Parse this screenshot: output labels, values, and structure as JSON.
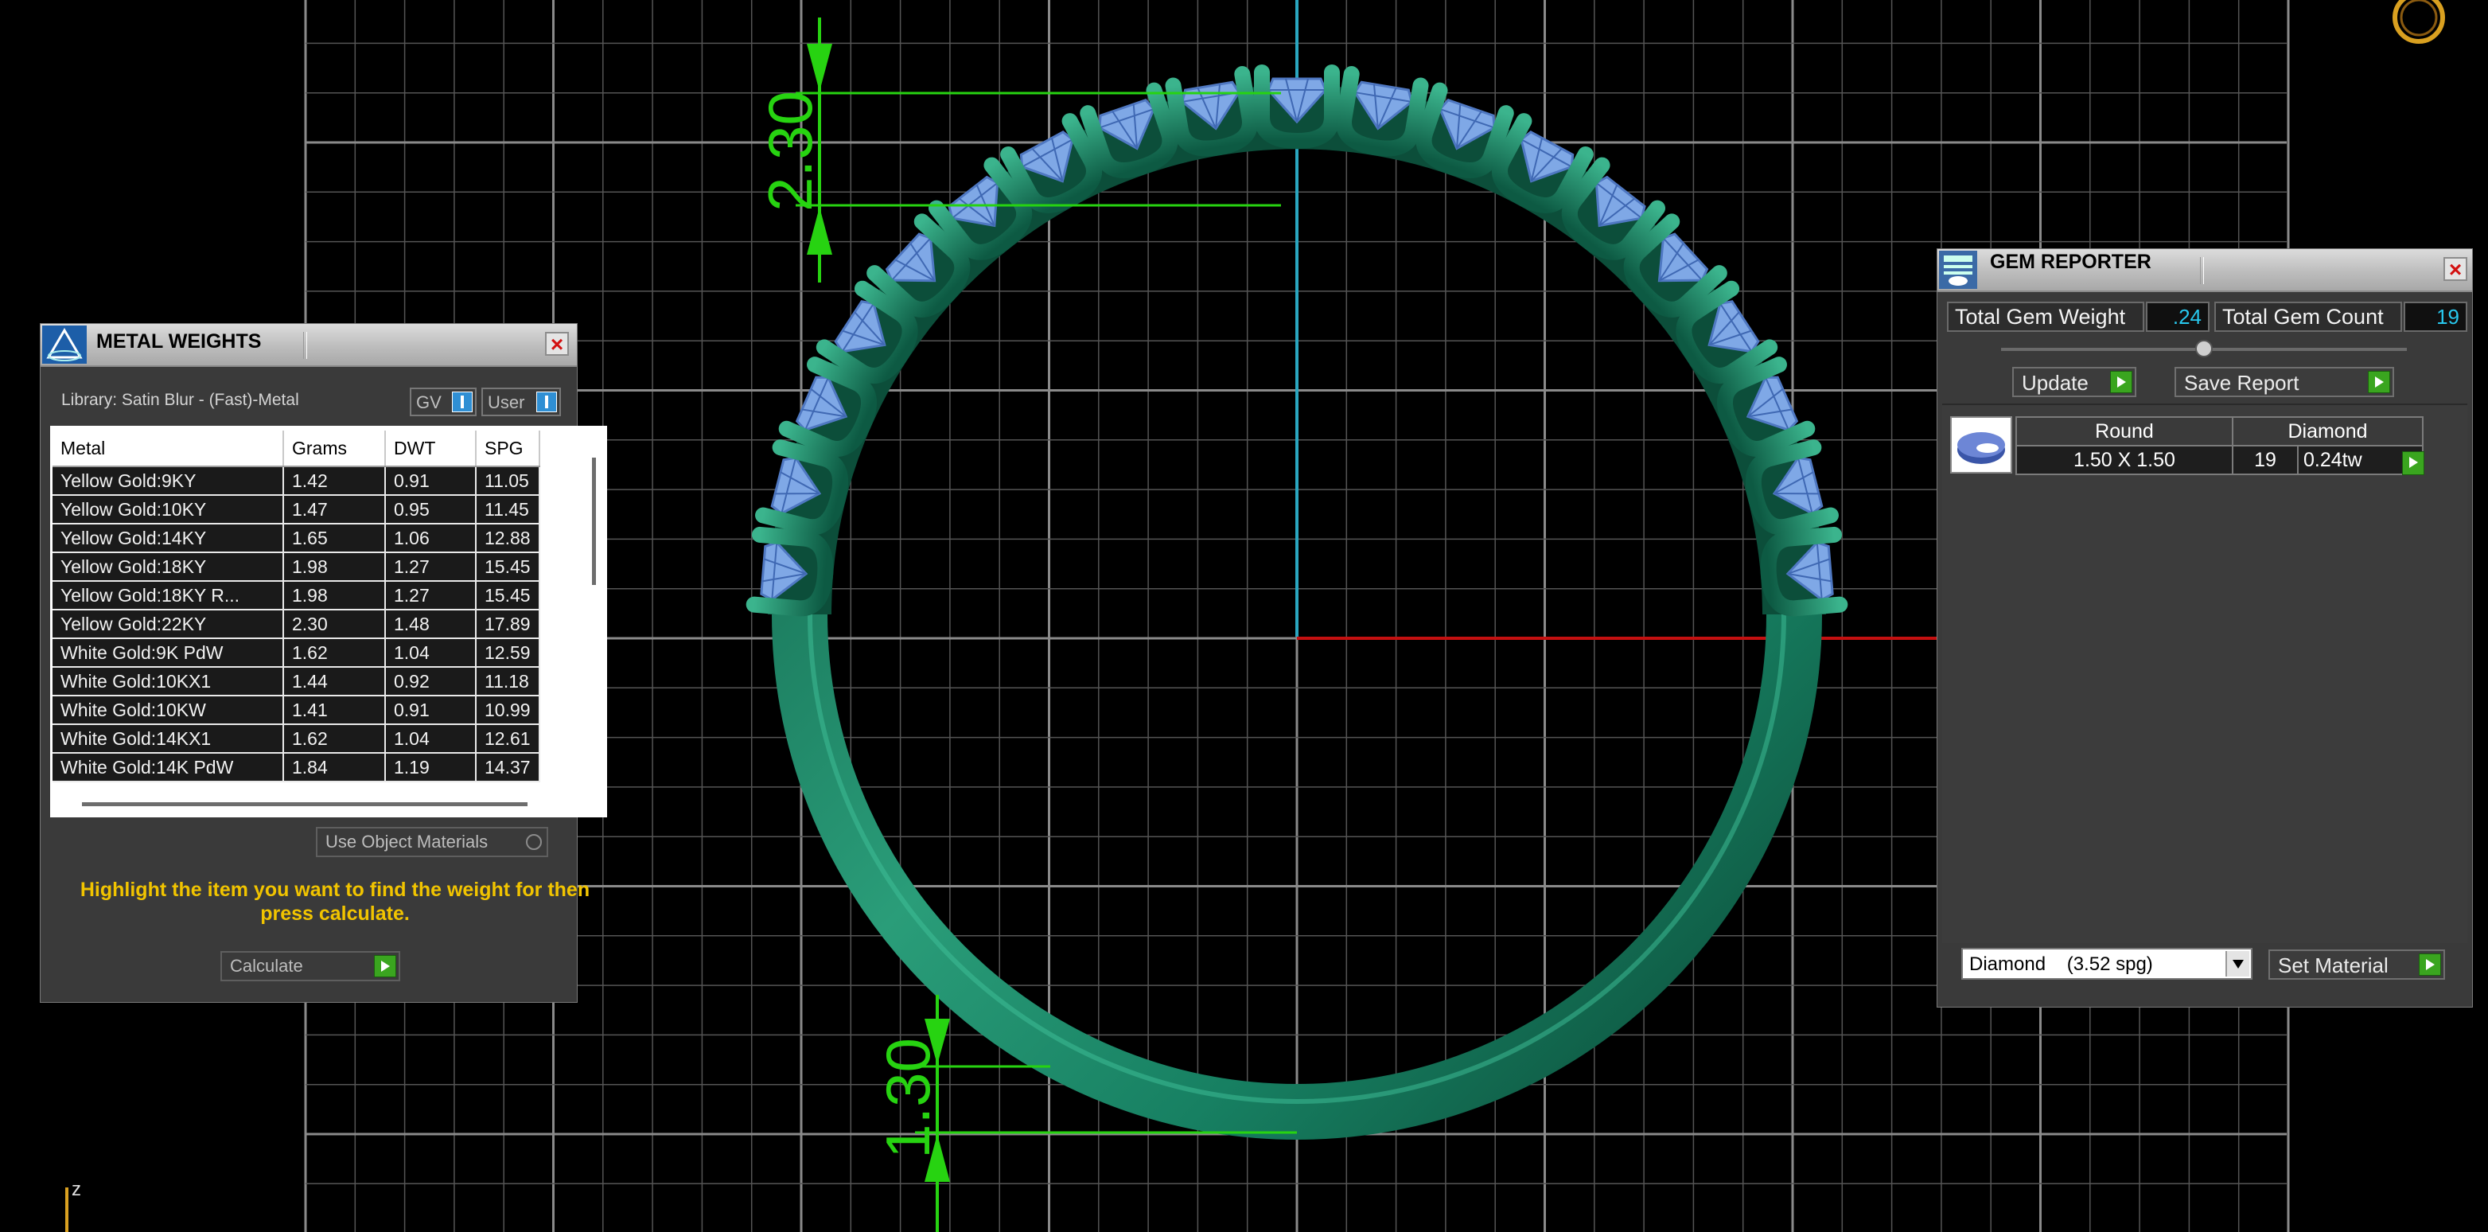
{
  "dimensions": {
    "top": "2.30",
    "bottom": "1.30"
  },
  "axis_label": "z",
  "metal_weights": {
    "title": "METAL WEIGHTS",
    "library": "Library: Satin Blur - (Fast)-Metal",
    "toggle_gv": "GV",
    "toggle_user": "User",
    "columns": [
      "Metal",
      "Grams",
      "DWT",
      "SPG"
    ],
    "rows": [
      [
        "Yellow Gold:9KY",
        "1.42",
        "0.91",
        "11.05"
      ],
      [
        "Yellow Gold:10KY",
        "1.47",
        "0.95",
        "11.45"
      ],
      [
        "Yellow Gold:14KY",
        "1.65",
        "1.06",
        "12.88"
      ],
      [
        "Yellow Gold:18KY",
        "1.98",
        "1.27",
        "15.45"
      ],
      [
        "Yellow Gold:18KY R...",
        "1.98",
        "1.27",
        "15.45"
      ],
      [
        "Yellow Gold:22KY",
        "2.30",
        "1.48",
        "17.89"
      ],
      [
        "White Gold:9K PdW",
        "1.62",
        "1.04",
        "12.59"
      ],
      [
        "White Gold:10KX1",
        "1.44",
        "0.92",
        "11.18"
      ],
      [
        "White Gold:10KW",
        "1.41",
        "0.91",
        "10.99"
      ],
      [
        "White Gold:14KX1",
        "1.62",
        "1.04",
        "12.61"
      ],
      [
        "White Gold:14K PdW",
        "1.84",
        "1.19",
        "14.37"
      ]
    ],
    "use_object_materials": "Use Object Materials",
    "hint": "Highlight the item you want to find the weight for then press calculate.",
    "calculate": "Calculate"
  },
  "gem_reporter": {
    "title": "GEM REPORTER",
    "total_weight_label": "Total Gem Weight",
    "total_weight_value": ".24",
    "total_count_label": "Total Gem Count",
    "total_count_value": "19",
    "update": "Update",
    "save_report": "Save Report",
    "gem_headers": [
      "Round",
      "Diamond"
    ],
    "gem_row": {
      "size": "1.50 X 1.50",
      "count": "19",
      "weight": "0.24tw"
    },
    "material_select": "Diamond    (3.52 spg)",
    "set_material": "Set Material"
  },
  "colors": {
    "ring": "#1f8a68",
    "gem": "#7fa8e6",
    "grid": "#6a6a6a",
    "dim": "#27d311",
    "axis_x": "#c41010",
    "axis_y": "#2aa6c0",
    "hint": "#f1c400"
  }
}
